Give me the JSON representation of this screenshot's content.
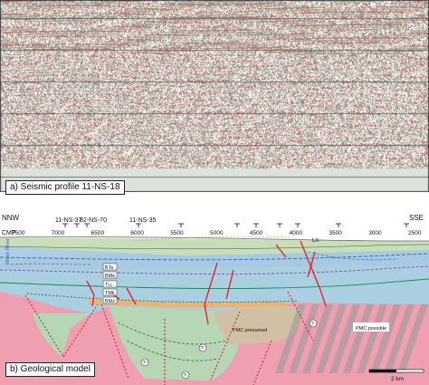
{
  "panel_a": {
    "label": "a) Seismic profile 11-NS-18"
  },
  "panel_b": {
    "label": "b) Geological model",
    "direction_left": "NNW",
    "direction_right": "SSE",
    "cmp_label": "CMP",
    "cmp_ticks": [
      "7500",
      "7000",
      "6500",
      "6000",
      "5500",
      "5000",
      "4500",
      "4000",
      "3500",
      "3000",
      "2500"
    ],
    "crossing_profiles": [
      "11-NS-37",
      "82-NS-70",
      "11-NS-35"
    ],
    "river_label": "Rhein River",
    "la_label": "LA",
    "unit_labels": [
      "BTe",
      "BMe",
      "TLi",
      "TMk",
      "BMz"
    ],
    "pmc_presumed": "PMC presumed",
    "pmc_possible": "PMC possible",
    "question_mark": "?",
    "scale_label": "2 km"
  },
  "colors": {
    "basement": "#ef9fb0",
    "trough": "#b7d6b6",
    "mesozoic": "#a9cfe0",
    "upper": "#a8c6e2",
    "quaternary": "#c7dfb9",
    "pmc": "#d2c0a6",
    "fault": "#e0262c"
  }
}
